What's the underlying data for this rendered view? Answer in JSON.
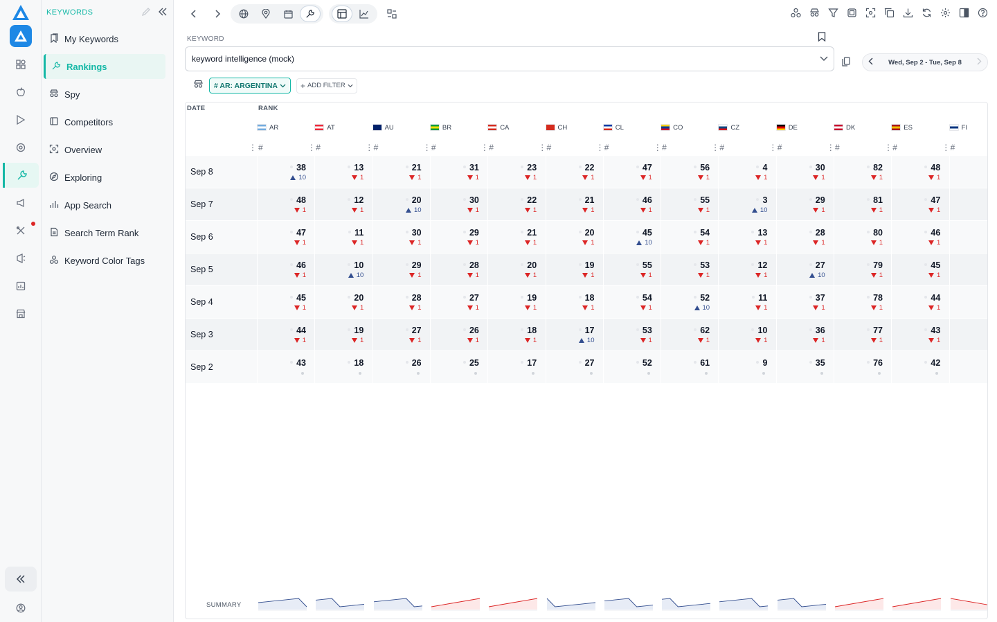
{
  "sidebar": {
    "heading": "KEYWORDS",
    "items": [
      {
        "label": "My Keywords",
        "icon": "bookmarks-icon",
        "active": false
      },
      {
        "label": "Rankings",
        "icon": "wrench-icon",
        "active": true
      },
      {
        "label": "Spy",
        "icon": "spy-icon",
        "active": false
      },
      {
        "label": "Competitors",
        "icon": "competitors-icon",
        "active": false
      },
      {
        "label": "Overview",
        "icon": "overview-icon",
        "active": false
      },
      {
        "label": "Exploring",
        "icon": "compass-icon",
        "active": false
      },
      {
        "label": "App Search",
        "icon": "bar-chart-icon",
        "active": false
      },
      {
        "label": "Search Term Rank",
        "icon": "document-icon",
        "active": false
      },
      {
        "label": "Keyword Color Tags",
        "icon": "color-tags-icon",
        "active": false
      }
    ]
  },
  "keyword": {
    "label": "KEYWORD",
    "value": "keyword intelligence (mock)"
  },
  "date_range": "Wed, Sep 2 - Tue, Sep 8",
  "filter": {
    "chip": "# AR: ARGENTINA",
    "add": "ADD FILTER"
  },
  "table": {
    "date_header": "DATE",
    "rank_header": "RANK",
    "sub_header": "#",
    "summary_label": "SUMMARY",
    "countries": [
      {
        "code": "AR",
        "colors": [
          "#74acdf",
          "#ffffff",
          "#74acdf"
        ]
      },
      {
        "code": "AT",
        "colors": [
          "#ed2939",
          "#ffffff",
          "#ed2939"
        ]
      },
      {
        "code": "AU",
        "colors": [
          "#012169",
          "#012169",
          "#012169"
        ]
      },
      {
        "code": "BR",
        "colors": [
          "#009c3b",
          "#ffdf00",
          "#009c3b"
        ]
      },
      {
        "code": "CA",
        "colors": [
          "#d52b1e",
          "#ffffff",
          "#d52b1e"
        ]
      },
      {
        "code": "CH",
        "colors": [
          "#d52b1e",
          "#d52b1e",
          "#d52b1e"
        ]
      },
      {
        "code": "CL",
        "colors": [
          "#0039a6",
          "#ffffff",
          "#d52b1e"
        ]
      },
      {
        "code": "CO",
        "colors": [
          "#fcd116",
          "#003893",
          "#ce1126"
        ]
      },
      {
        "code": "CZ",
        "colors": [
          "#ffffff",
          "#11457e",
          "#d7141a"
        ]
      },
      {
        "code": "DE",
        "colors": [
          "#000000",
          "#dd0000",
          "#ffce00"
        ]
      },
      {
        "code": "DK",
        "colors": [
          "#c8102e",
          "#ffffff",
          "#c8102e"
        ]
      },
      {
        "code": "ES",
        "colors": [
          "#aa151b",
          "#f1bf00",
          "#aa151b"
        ]
      },
      {
        "code": "FI",
        "colors": [
          "#ffffff",
          "#003580",
          "#ffffff"
        ]
      }
    ],
    "rows": [
      {
        "date": "Sep 8",
        "cells": [
          {
            "rank": "38",
            "dir": "up",
            "chg": "10"
          },
          {
            "rank": "13",
            "dir": "down",
            "chg": "1"
          },
          {
            "rank": "21",
            "dir": "down",
            "chg": "1"
          },
          {
            "rank": "31",
            "dir": "down",
            "chg": "1"
          },
          {
            "rank": "23",
            "dir": "down",
            "chg": "1"
          },
          {
            "rank": "22",
            "dir": "down",
            "chg": "1"
          },
          {
            "rank": "47",
            "dir": "down",
            "chg": "1"
          },
          {
            "rank": "56",
            "dir": "down",
            "chg": "1"
          },
          {
            "rank": "4",
            "dir": "down",
            "chg": "1"
          },
          {
            "rank": "30",
            "dir": "down",
            "chg": "1"
          },
          {
            "rank": "82",
            "dir": "down",
            "chg": "1"
          },
          {
            "rank": "48",
            "dir": "down",
            "chg": "1"
          }
        ]
      },
      {
        "date": "Sep 7",
        "cells": [
          {
            "rank": "48",
            "dir": "down",
            "chg": "1"
          },
          {
            "rank": "12",
            "dir": "down",
            "chg": "1"
          },
          {
            "rank": "20",
            "dir": "up",
            "chg": "10"
          },
          {
            "rank": "30",
            "dir": "down",
            "chg": "1"
          },
          {
            "rank": "22",
            "dir": "down",
            "chg": "1"
          },
          {
            "rank": "21",
            "dir": "down",
            "chg": "1"
          },
          {
            "rank": "46",
            "dir": "down",
            "chg": "1"
          },
          {
            "rank": "55",
            "dir": "down",
            "chg": "1"
          },
          {
            "rank": "3",
            "dir": "up",
            "chg": "10"
          },
          {
            "rank": "29",
            "dir": "down",
            "chg": "1"
          },
          {
            "rank": "81",
            "dir": "down",
            "chg": "1"
          },
          {
            "rank": "47",
            "dir": "down",
            "chg": "1"
          }
        ]
      },
      {
        "date": "Sep 6",
        "cells": [
          {
            "rank": "47",
            "dir": "down",
            "chg": "1"
          },
          {
            "rank": "11",
            "dir": "down",
            "chg": "1"
          },
          {
            "rank": "30",
            "dir": "down",
            "chg": "1"
          },
          {
            "rank": "29",
            "dir": "down",
            "chg": "1"
          },
          {
            "rank": "21",
            "dir": "down",
            "chg": "1"
          },
          {
            "rank": "20",
            "dir": "down",
            "chg": "1"
          },
          {
            "rank": "45",
            "dir": "up",
            "chg": "10"
          },
          {
            "rank": "54",
            "dir": "down",
            "chg": "1"
          },
          {
            "rank": "13",
            "dir": "down",
            "chg": "1"
          },
          {
            "rank": "28",
            "dir": "down",
            "chg": "1"
          },
          {
            "rank": "80",
            "dir": "down",
            "chg": "1"
          },
          {
            "rank": "46",
            "dir": "down",
            "chg": "1"
          }
        ]
      },
      {
        "date": "Sep 5",
        "cells": [
          {
            "rank": "46",
            "dir": "down",
            "chg": "1"
          },
          {
            "rank": "10",
            "dir": "up",
            "chg": "10"
          },
          {
            "rank": "29",
            "dir": "down",
            "chg": "1"
          },
          {
            "rank": "28",
            "dir": "down",
            "chg": "1"
          },
          {
            "rank": "20",
            "dir": "down",
            "chg": "1"
          },
          {
            "rank": "19",
            "dir": "down",
            "chg": "1"
          },
          {
            "rank": "55",
            "dir": "down",
            "chg": "1"
          },
          {
            "rank": "53",
            "dir": "down",
            "chg": "1"
          },
          {
            "rank": "12",
            "dir": "down",
            "chg": "1"
          },
          {
            "rank": "27",
            "dir": "up",
            "chg": "10"
          },
          {
            "rank": "79",
            "dir": "down",
            "chg": "1"
          },
          {
            "rank": "45",
            "dir": "down",
            "chg": "1"
          }
        ]
      },
      {
        "date": "Sep 4",
        "cells": [
          {
            "rank": "45",
            "dir": "down",
            "chg": "1"
          },
          {
            "rank": "20",
            "dir": "down",
            "chg": "1"
          },
          {
            "rank": "28",
            "dir": "down",
            "chg": "1"
          },
          {
            "rank": "27",
            "dir": "down",
            "chg": "1"
          },
          {
            "rank": "19",
            "dir": "down",
            "chg": "1"
          },
          {
            "rank": "18",
            "dir": "down",
            "chg": "1"
          },
          {
            "rank": "54",
            "dir": "down",
            "chg": "1"
          },
          {
            "rank": "52",
            "dir": "up",
            "chg": "10"
          },
          {
            "rank": "11",
            "dir": "down",
            "chg": "1"
          },
          {
            "rank": "37",
            "dir": "down",
            "chg": "1"
          },
          {
            "rank": "78",
            "dir": "down",
            "chg": "1"
          },
          {
            "rank": "44",
            "dir": "down",
            "chg": "1"
          }
        ]
      },
      {
        "date": "Sep 3",
        "cells": [
          {
            "rank": "44",
            "dir": "down",
            "chg": "1"
          },
          {
            "rank": "19",
            "dir": "down",
            "chg": "1"
          },
          {
            "rank": "27",
            "dir": "down",
            "chg": "1"
          },
          {
            "rank": "26",
            "dir": "down",
            "chg": "1"
          },
          {
            "rank": "18",
            "dir": "down",
            "chg": "1"
          },
          {
            "rank": "17",
            "dir": "up",
            "chg": "10"
          },
          {
            "rank": "53",
            "dir": "down",
            "chg": "1"
          },
          {
            "rank": "62",
            "dir": "down",
            "chg": "1"
          },
          {
            "rank": "10",
            "dir": "down",
            "chg": "1"
          },
          {
            "rank": "36",
            "dir": "down",
            "chg": "1"
          },
          {
            "rank": "77",
            "dir": "down",
            "chg": "1"
          },
          {
            "rank": "43",
            "dir": "down",
            "chg": "1"
          }
        ]
      },
      {
        "date": "Sep 2",
        "cells": [
          {
            "rank": "43",
            "dir": "none",
            "chg": ""
          },
          {
            "rank": "18",
            "dir": "none",
            "chg": ""
          },
          {
            "rank": "26",
            "dir": "none",
            "chg": ""
          },
          {
            "rank": "25",
            "dir": "none",
            "chg": ""
          },
          {
            "rank": "17",
            "dir": "none",
            "chg": ""
          },
          {
            "rank": "27",
            "dir": "none",
            "chg": ""
          },
          {
            "rank": "52",
            "dir": "none",
            "chg": ""
          },
          {
            "rank": "61",
            "dir": "none",
            "chg": ""
          },
          {
            "rank": "9",
            "dir": "none",
            "chg": ""
          },
          {
            "rank": "35",
            "dir": "none",
            "chg": ""
          },
          {
            "rank": "76",
            "dir": "none",
            "chg": ""
          },
          {
            "rank": "42",
            "dir": "none",
            "chg": ""
          }
        ]
      }
    ]
  },
  "colors": {
    "accent": "#14b8a6",
    "down": "#dc2626",
    "up": "#334e8f"
  }
}
